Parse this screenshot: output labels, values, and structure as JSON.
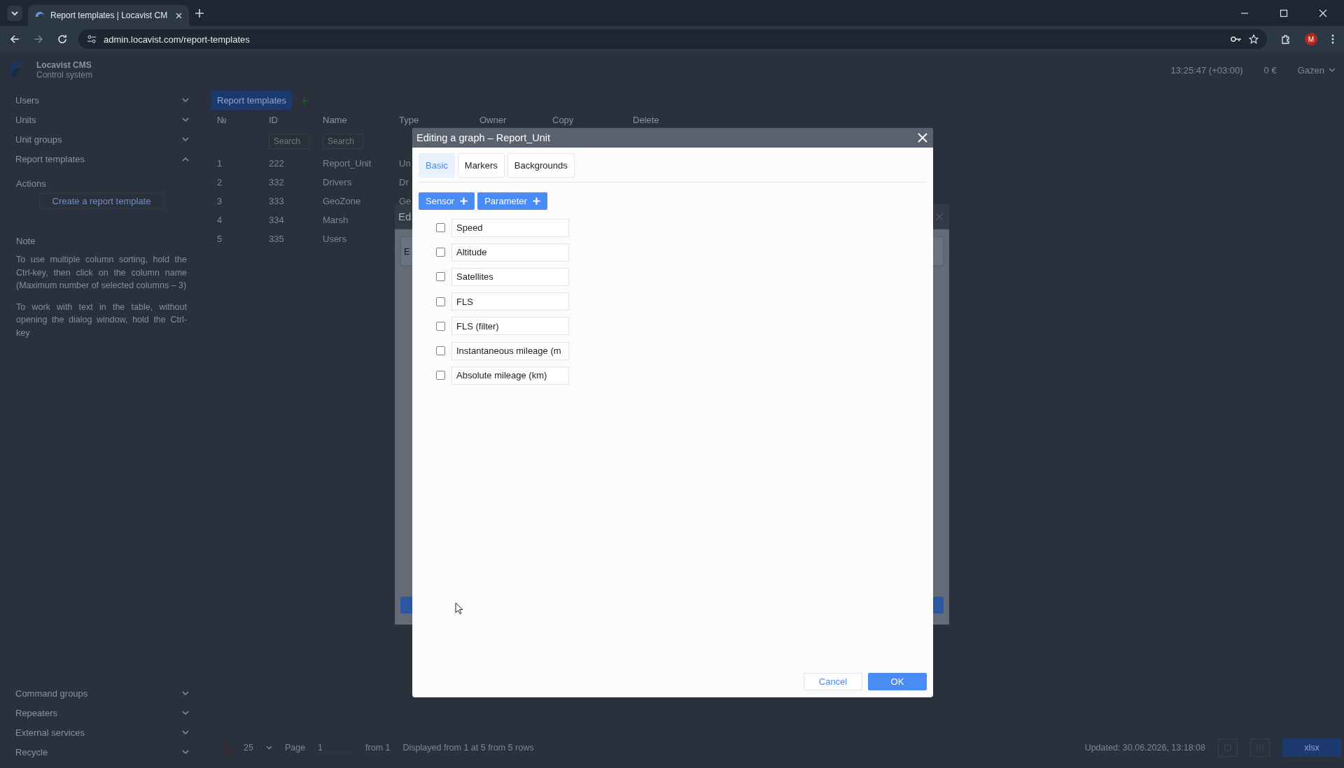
{
  "browser": {
    "tab_title": "Report templates | Locavist CM",
    "url": "admin.locavist.com/report-templates",
    "profile_initial": "M"
  },
  "header": {
    "app_name": "Locavist CMS",
    "app_subtitle": "Control system",
    "time": "13:25:47 (+03:00)",
    "balance": "0 €",
    "user": "Gazen"
  },
  "sidebar": {
    "items": [
      {
        "label": "Users",
        "expanded": false
      },
      {
        "label": "Units",
        "expanded": false
      },
      {
        "label": "Unit groups",
        "expanded": false
      },
      {
        "label": "Report templates",
        "expanded": true
      }
    ],
    "actions_title": "Actions",
    "action_link": "Create a report template",
    "note_title": "Note",
    "note_paragraphs": [
      "To use multiple column sorting, hold the Ctrl-key, then click on the column name (Maximum number of selected columns – 3)",
      "To work with text in the table, without opening the dialog window, hold the Ctrl-key"
    ],
    "bottom_items": [
      {
        "label": "Command groups",
        "expanded": false
      },
      {
        "label": "Repeaters",
        "expanded": false
      },
      {
        "label": "External services",
        "expanded": false
      },
      {
        "label": "Recycle",
        "expanded": false
      }
    ]
  },
  "main": {
    "tab_label": "Report templates",
    "columns": [
      "№",
      "ID",
      "Name",
      "Type",
      "Owner",
      "Copy",
      "Delete"
    ],
    "search_placeholders": [
      "Search",
      "Search"
    ],
    "rows": [
      {
        "n": "1",
        "id": "222",
        "name": "Report_Unit",
        "type": "Un"
      },
      {
        "n": "2",
        "id": "332",
        "name": "Drivers",
        "type": "Dr"
      },
      {
        "n": "3",
        "id": "333",
        "name": "GeoZone",
        "type": "Ge"
      },
      {
        "n": "4",
        "id": "334",
        "name": "Marsh"
      },
      {
        "n": "5",
        "id": "335",
        "name": "Users"
      }
    ]
  },
  "back_dialog": {
    "title": "Ed",
    "tab": "E"
  },
  "dialog": {
    "title": "Editing a graph – Report_Unit",
    "tabs": [
      {
        "label": "Basic",
        "selected": true
      },
      {
        "label": "Markers",
        "selected": false
      },
      {
        "label": "Backgrounds",
        "selected": false
      }
    ],
    "add_buttons": [
      "Sensor",
      "Parameter"
    ],
    "items": [
      {
        "label": "Speed",
        "checked": false
      },
      {
        "label": "Altitude",
        "checked": false
      },
      {
        "label": "Satellites",
        "checked": false
      },
      {
        "label": "FLS",
        "checked": false
      },
      {
        "label": "FLS (filter)",
        "checked": false
      },
      {
        "label": "Instantaneous mileage (m",
        "checked": false
      },
      {
        "label": "Absolute mileage (km)",
        "checked": false
      }
    ],
    "cancel": "Cancel",
    "ok": "OK"
  },
  "footer": {
    "page_size": "25",
    "page_label": "Page",
    "page": "1",
    "page_total": "from 1",
    "summary": "Displayed from 1 at 5 from 5 rows",
    "updated": "Updated: 30.06.2026, 13:18:08",
    "export": "xlsx"
  }
}
